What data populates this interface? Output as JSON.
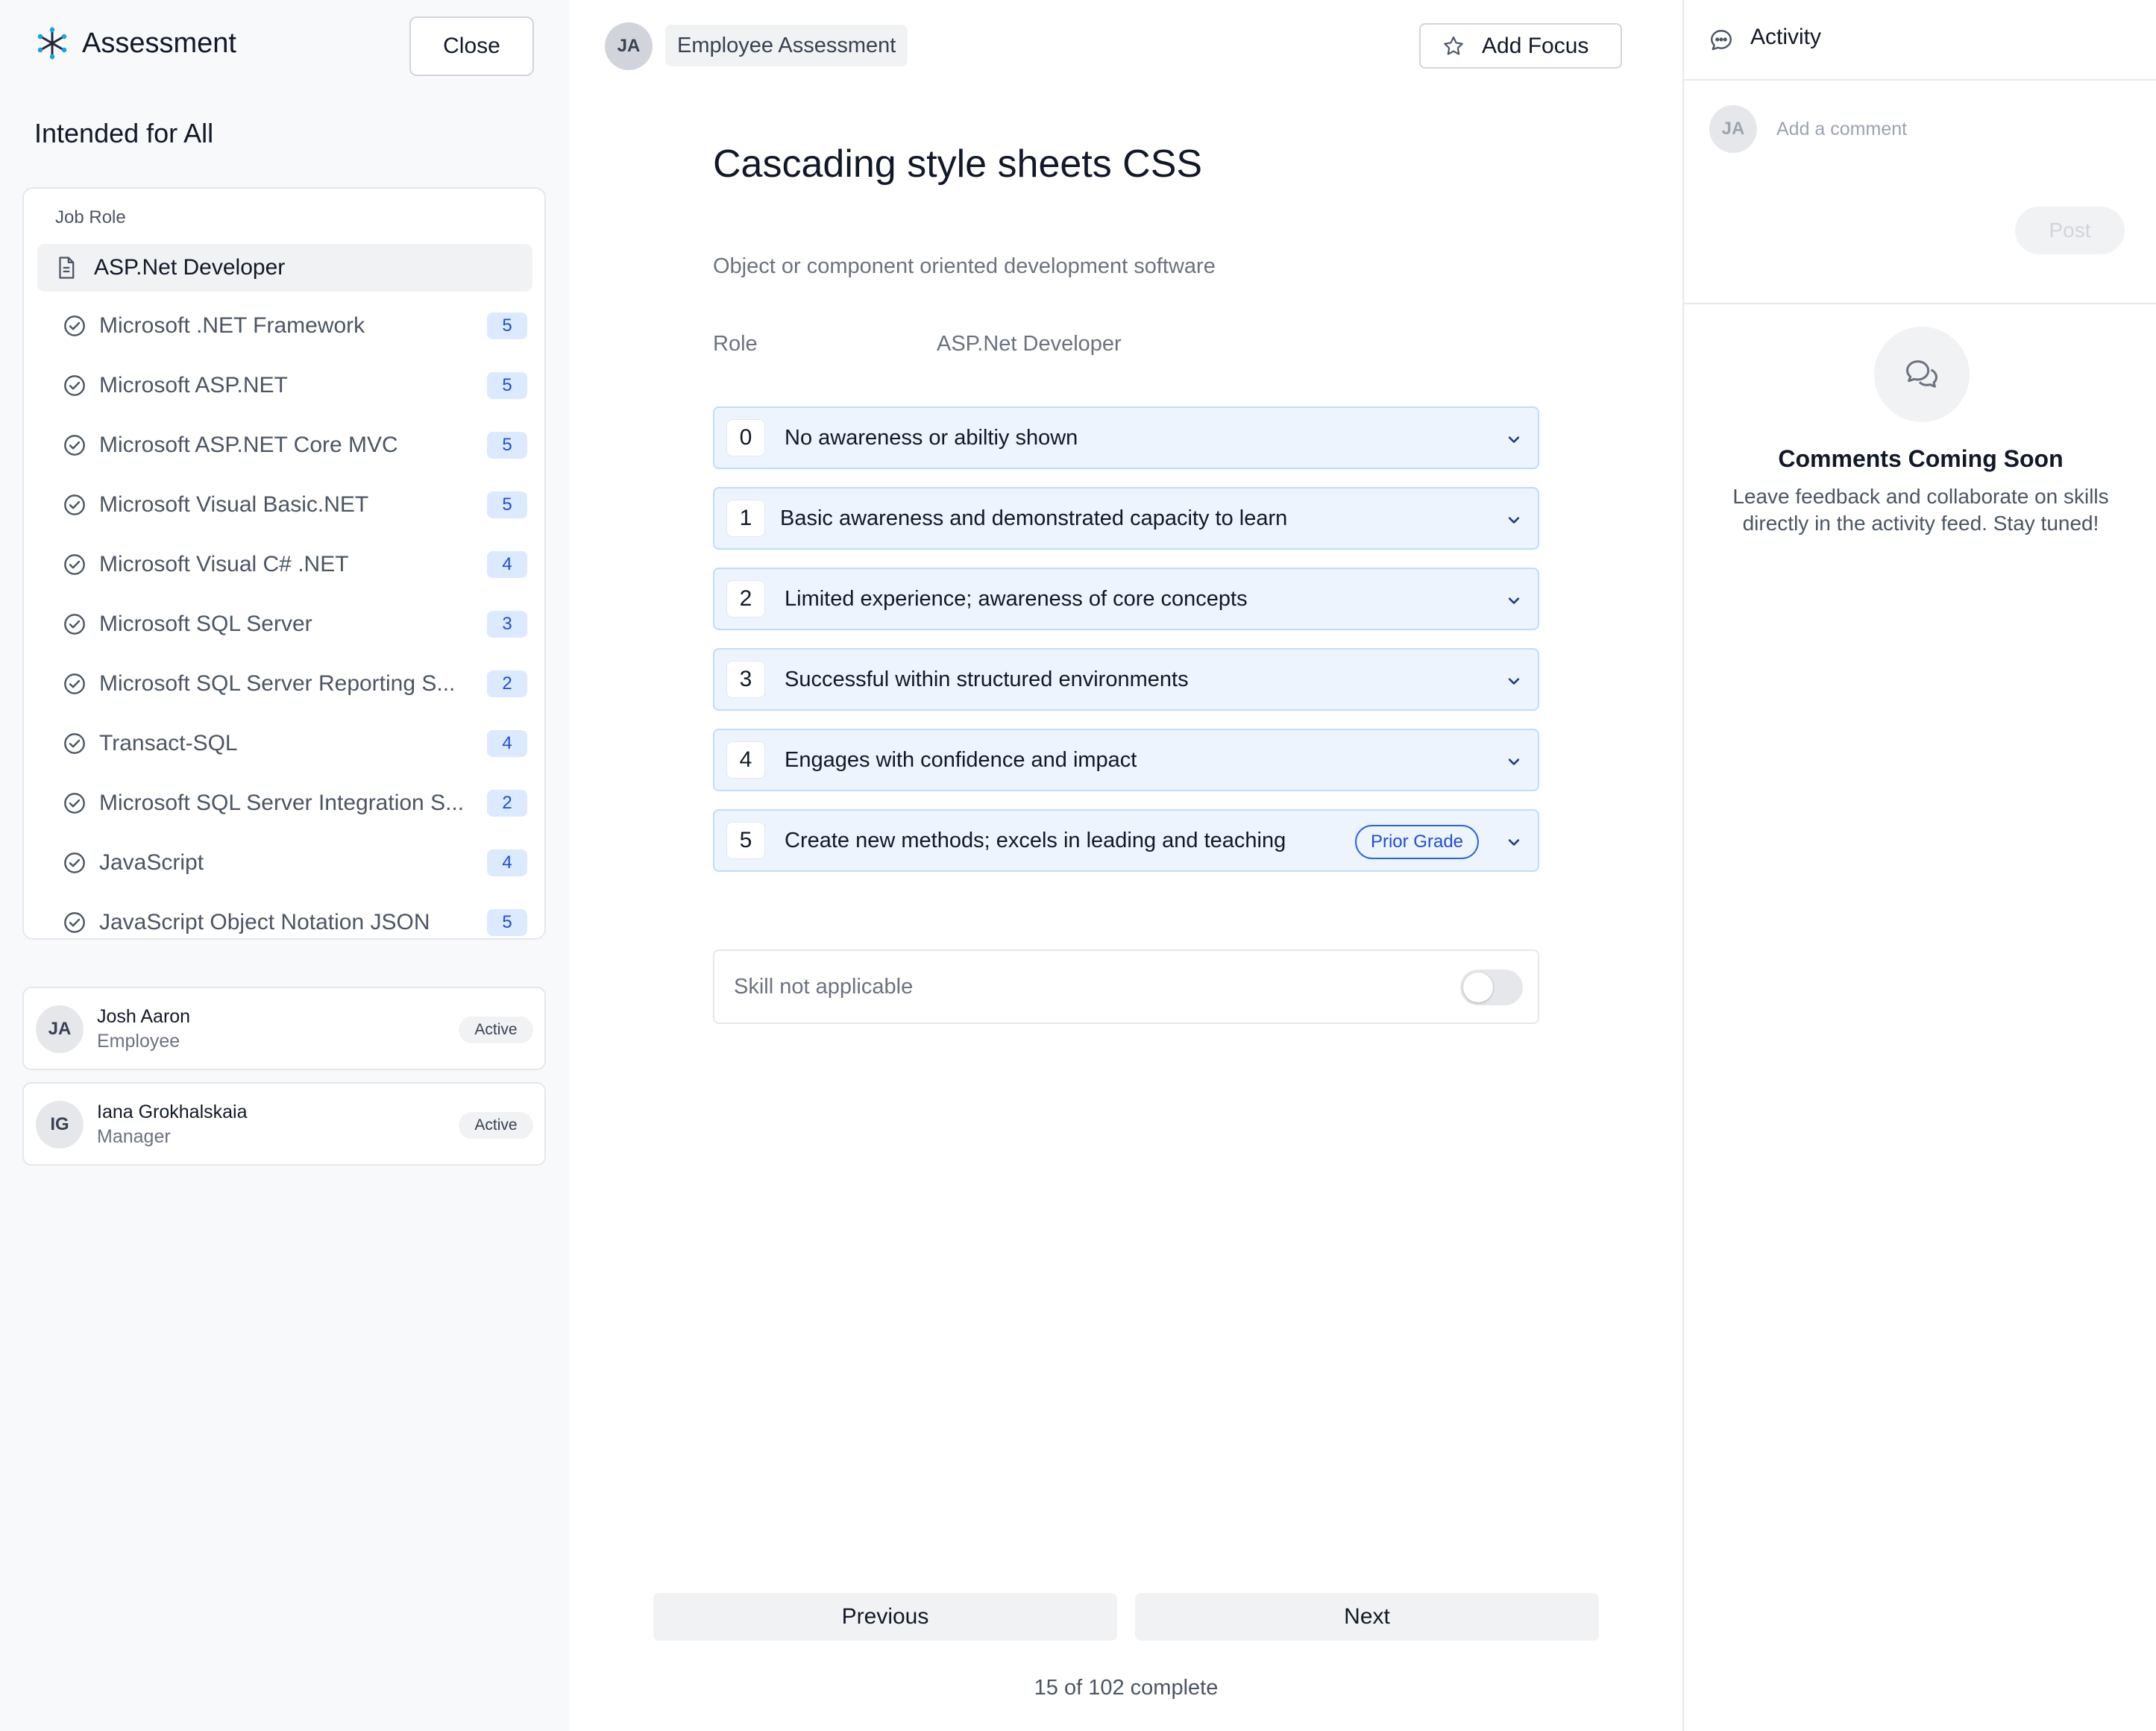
{
  "app": {
    "title": "Assessment",
    "close_label": "Close"
  },
  "sidebar": {
    "audience": "Intended for All",
    "job_role_heading": "Job Role",
    "job_role": "ASP.Net Developer",
    "skills": [
      {
        "label": "Microsoft .NET Framework",
        "count": "5"
      },
      {
        "label": "Microsoft ASP.NET",
        "count": "5"
      },
      {
        "label": "Microsoft ASP.NET Core MVC",
        "count": "5"
      },
      {
        "label": "Microsoft Visual Basic.NET",
        "count": "5"
      },
      {
        "label": "Microsoft Visual C# .NET",
        "count": "4"
      },
      {
        "label": "Microsoft SQL Server",
        "count": "3"
      },
      {
        "label": "Microsoft SQL Server Reporting S...",
        "count": "2"
      },
      {
        "label": "Transact-SQL",
        "count": "4"
      },
      {
        "label": "Microsoft SQL Server Integration S...",
        "count": "2"
      },
      {
        "label": "JavaScript",
        "count": "4"
      },
      {
        "label": "JavaScript Object Notation JSON",
        "count": "5"
      }
    ],
    "people": [
      {
        "initials": "JA",
        "name": "Josh Aaron",
        "role": "Employee",
        "status": "Active"
      },
      {
        "initials": "IG",
        "name": "Iana Grokhalskaia",
        "role": "Manager",
        "status": "Active"
      }
    ]
  },
  "header": {
    "user_initials": "JA",
    "assessment_label": "Employee Assessment",
    "focus_label": "Add Focus"
  },
  "skill": {
    "title": "Cascading style sheets CSS",
    "description": "Object or component oriented development software",
    "role_label": "Role",
    "role_value": "ASP.Net Developer",
    "levels": [
      {
        "number": "0",
        "text": "No awareness or abiltiy shown"
      },
      {
        "number": "1",
        "text": "Basic awareness and demonstrated capacity to learn"
      },
      {
        "number": "2",
        "text": "Limited experience; awareness of core concepts"
      },
      {
        "number": "3",
        "text": "Successful within structured environments"
      },
      {
        "number": "4",
        "text": "Engages with confidence and impact"
      },
      {
        "number": "5",
        "text": "Create new methods; excels in leading and teaching",
        "badge": "Prior Grade"
      }
    ],
    "not_applicable_label": "Skill not applicable",
    "not_applicable": false
  },
  "nav": {
    "previous_label": "Previous",
    "next_label": "Next",
    "progress_text": "15 of 102 complete"
  },
  "activity": {
    "title": "Activity",
    "user_initials": "JA",
    "comment_placeholder": "Add a comment",
    "post_label": "Post",
    "empty_title": "Comments Coming Soon",
    "empty_text": "Leave feedback and collaborate on skills directly in the activity feed. Stay tuned!"
  },
  "colors": {
    "accent": "#1d4ed8",
    "level_bg": "#eef4fd",
    "level_border": "#bfdbfe",
    "sidebar_bg": "#f8f9fb"
  }
}
